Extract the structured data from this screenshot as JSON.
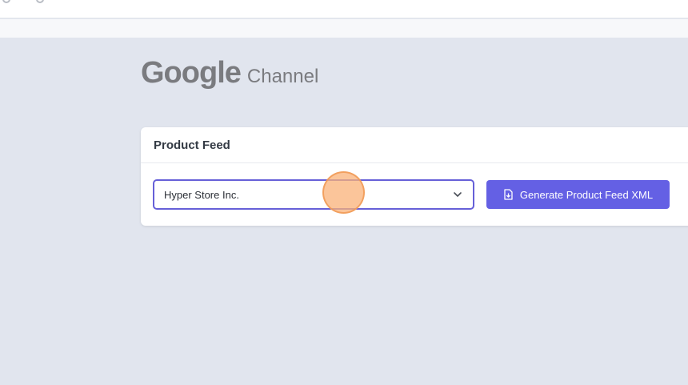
{
  "brand": {
    "logo_text": "Google",
    "subtitle": "Channel"
  },
  "card": {
    "title": "Product Feed",
    "store_select": {
      "selected": "Hyper Store Inc."
    },
    "generate_button_label": "Generate Product Feed XML"
  },
  "icons": {
    "select_chevron": "chevron-down-icon",
    "generate_button_icon": "file-download-icon"
  },
  "colors": {
    "accent": "#6460e4",
    "select_border": "#6660d8",
    "background": "#e1e5ee",
    "click_marker": "#f9b278"
  }
}
